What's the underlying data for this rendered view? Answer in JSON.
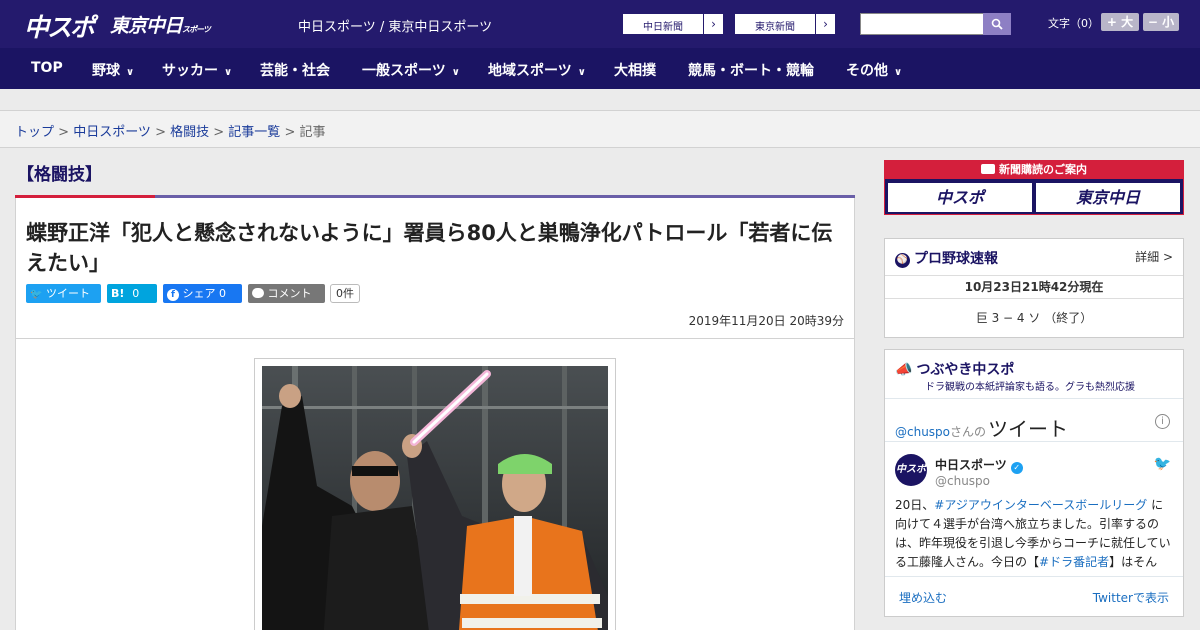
{
  "header": {
    "logo_main": "中スポ",
    "logo_sub": "東京中日",
    "logo_sub_small": "スポーツ",
    "site_name": "中日スポーツ / 東京中日スポーツ",
    "link_chunichi": "中日新聞",
    "link_tokyo": "東京新聞",
    "search_placeholder": "",
    "font_label": "文字（0）",
    "font_bigger": "+ 大",
    "font_smaller": "− 小"
  },
  "nav": {
    "top": "TOP",
    "baseball": "野球",
    "soccer": "サッカー",
    "entertainment": "芸能・社会",
    "sports": "一般スポーツ",
    "local_sports": "地域スポーツ",
    "sumo": "大相撲",
    "racing": "競馬・ボート・競輪",
    "other": "その他"
  },
  "breadcrumb": {
    "top": "トップ",
    "chunichi_sports": "中日スポーツ",
    "martial_arts": "格闘技",
    "article_list": "記事一覧",
    "current": "記事",
    "separator": " > "
  },
  "article": {
    "category": "【格闘技】",
    "headline": "蝶野正洋「犯人と懸念されないように」署員ら80人と巣鴨浄化パトロール「若者に伝えたい」",
    "tweet_label": "ツイート",
    "hatena_label": "B!",
    "hatena_count": "0",
    "share_label": "シェア",
    "share_count": "0",
    "comment_label": "コメント",
    "comment_count": "0件",
    "date": "2019年11月20日 20時39分"
  },
  "sidebar": {
    "subscribe_title": "新聞購読のご案内",
    "subscribe_chuspo": "中スポ",
    "subscribe_tokyo": "東京中日",
    "baseball": {
      "title": "プロ野球速報",
      "more": "詳細 >",
      "timestamp": "10月23日21時42分現在",
      "score": "巨 3 − 4 ソ （終了）"
    },
    "twitter": {
      "title": "つぶやき中スポ",
      "subtitle": "ドラ観戦の本紙評論家も語る。グラも熱烈応援",
      "handle": "@chuspo",
      "handle_suffix": "さんの",
      "tweets_label": "ツイート",
      "user_name": "中日スポーツ",
      "user_handle": "@chuspo",
      "avatar_text": "中スポ",
      "tweet_part1": "20日、",
      "tweet_hashtag1": "#アジアウインターベースボールリーグ",
      "tweet_part2": " に向けて４選手が台湾へ旅立ちました。引率するのは、昨年現役を引退し今季からコーチに就任している工藤隆人さん。今日の【",
      "tweet_hashtag2": "#ドラ番記者",
      "tweet_part3": "】はそんな“新米",
      "embed_label": "埋め込む",
      "view_on_twitter": "Twitterで表示"
    }
  },
  "colors": {
    "header_bg": "#241a6d",
    "nav_bg": "#1b1463",
    "accent_red": "#d41f3c",
    "twitter_blue": "#1da1f2",
    "facebook_blue": "#1877f2",
    "hatena_blue": "#00a4de"
  }
}
